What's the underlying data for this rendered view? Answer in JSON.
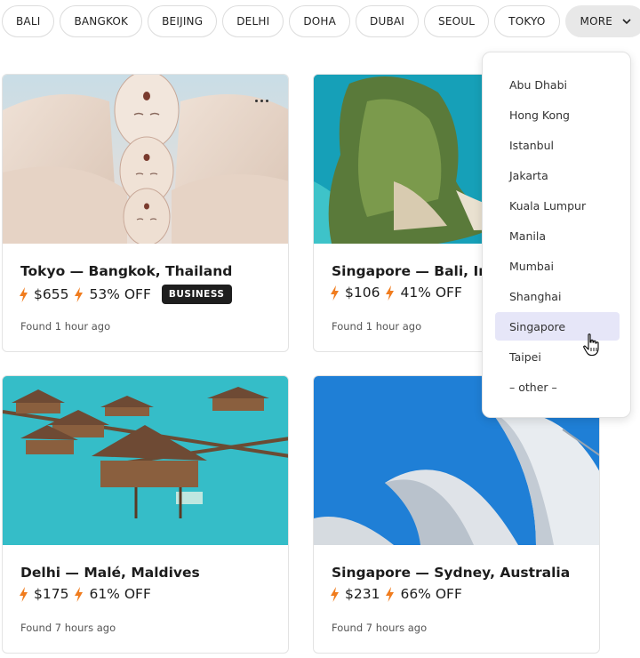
{
  "chips": [
    "BALI",
    "BANGKOK",
    "BEIJING",
    "DELHI",
    "DOHA",
    "DUBAI",
    "SEOUL",
    "TOKYO"
  ],
  "more_label": "MORE",
  "dropdown": {
    "items": [
      "Abu Dhabi",
      "Hong Kong",
      "Istanbul",
      "Jakarta",
      "Kuala Lumpur",
      "Manila",
      "Mumbai",
      "Shanghai",
      "Singapore",
      "Taipei",
      "– other –"
    ],
    "selected": "Singapore"
  },
  "cards": [
    {
      "title": "Tokyo — Bangkok, Thailand",
      "price": "$655",
      "discount": "53% OFF",
      "badge": "BUSINESS",
      "found": "Found 1 hour ago"
    },
    {
      "title": "Singapore — Bali, Indonesia",
      "price": "$106",
      "discount": "41% OFF",
      "found": "Found 1 hour ago"
    },
    {
      "title": "Delhi — Malé, Maldives",
      "price": "$175",
      "discount": "61% OFF",
      "found": "Found 7 hours ago"
    },
    {
      "title": "Singapore — Sydney, Australia",
      "price": "$231",
      "discount": "66% OFF",
      "found": "Found 7 hours ago"
    }
  ],
  "colors": {
    "accent_bolt": "#f07c1e",
    "badge_bg": "#1e1e1e",
    "selected_bg": "#e6e6f8"
  },
  "icons": {
    "chevron": "chevron-down-icon",
    "bolt": "bolt-icon",
    "more": "more-options-icon",
    "cursor": "pointer-hand-cursor"
  }
}
